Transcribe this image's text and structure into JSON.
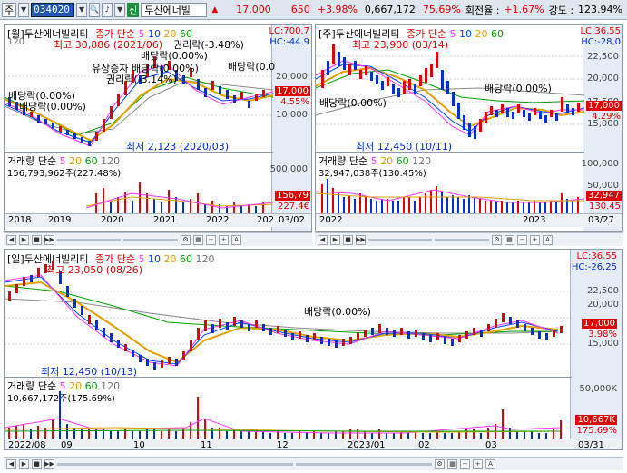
{
  "toolbar": {
    "mode": "주",
    "code": "034020",
    "badge": "신",
    "name": "두산에너빌",
    "price": "17,000",
    "arrow": "▲",
    "change": "650",
    "change_pct": "+3.98%",
    "volume": "0,667,172",
    "vol_pct": "75.69%",
    "turnover_label": "회전율 :",
    "turnover": "+1.67%",
    "strength_label": "강도 :",
    "strength": "123.94%"
  },
  "panels": {
    "monthly": {
      "title": "[월]두산에너빌리티",
      "ma_label": "종가 단순",
      "ma": [
        "5",
        "10",
        "20",
        "60"
      ],
      "ma120": "120",
      "lc": "LC:700.7",
      "hc": "HC:-44.9",
      "high_note": "최고 30,886 (2021/06)",
      "low_note": "최저 2,123 (2020/03)",
      "events": [
        "배당락(0.00%)",
        "유상증자 배당락(0.00%)",
        "권리락(-3.14%)",
        "배당락(0.00%)",
        "권리락(-3.48%)",
        "배당락(0.0",
        "배당락(0.00%)"
      ],
      "price_box": "17,000",
      "pct_box": "4.55%",
      "ticks": [
        "20,000",
        "10,000"
      ],
      "vol_title": "거래량 단순",
      "vol_ma": [
        "5",
        "20",
        "60",
        "120"
      ],
      "vol_text": "156,793,962주(227.48%)",
      "vol_tick": "500,000",
      "vol_box1": "156,79",
      "vol_box2": "227.4€",
      "x_labels": [
        "2018",
        "2019",
        "2020",
        "2021",
        "2022",
        "202"
      ],
      "date": "03/02"
    },
    "weekly": {
      "title": "[주]두산에너빌리티",
      "ma_label": "종가 단순",
      "ma": [
        "5",
        "10",
        "20",
        "60"
      ],
      "lc": "LC:36,55",
      "hc": "HC:-28,0",
      "high_note": "최고 23,900 (03/14)",
      "low_note": "최저 12,450 (10/11)",
      "events": [
        "배당락(0.00%)",
        "배당락(0.00%)"
      ],
      "price_box": "17,000",
      "pct_box": "4.29%",
      "ticks": [
        "22,500",
        "20,000",
        "17,500",
        "15,000"
      ],
      "vol_title": "거래량 단순",
      "vol_ma": [
        "5",
        "20",
        "60",
        "120"
      ],
      "vol_text": "32,947,038주(130.45%)",
      "vol_tick": "100,000",
      "vol_tick2": "50,000",
      "vol_box1": "32,947",
      "vol_box2": "130.45",
      "x_labels": [
        "2022",
        "2023"
      ],
      "date": "03/27"
    },
    "daily": {
      "title": "[일]두산에너빌리티",
      "ma_label": "종가 단순",
      "ma": [
        "5",
        "10",
        "20",
        "60",
        "120"
      ],
      "lc": "LC:36.55",
      "hc": "HC:-26.25",
      "high_note": "최고 23,050 (08/26)",
      "low_note": "최저 12,450 (10/13)",
      "events": [
        "배당락(0.00%)"
      ],
      "price_box": "17,000",
      "pct_box": "3.98%",
      "ticks": [
        "22,500",
        "20,000",
        "17,500",
        "15,000"
      ],
      "vol_title": "거래량 단순",
      "vol_ma": [
        "5",
        "20",
        "60",
        "120"
      ],
      "vol_text": "10,667,172주(175.69%)",
      "vol_tick": "50,000K",
      "vol_box1": "10,667K",
      "vol_box2": "175.69%",
      "x_labels": [
        "2022/08",
        "09",
        "10",
        "11",
        "12",
        "2023/01",
        "02",
        "03"
      ],
      "date": "03/31"
    }
  },
  "colors": {
    "up": "#e00000",
    "down": "#0030d0",
    "ma5": "#ff33ff",
    "ma10": "#0044ff",
    "ma20": "#e0a000",
    "ma60": "#00a000",
    "ma120": "#888888"
  },
  "controls": {
    "buttons": [
      "◀",
      "▶",
      "■",
      "▶▶"
    ],
    "zoom_out": "−",
    "zoom_in": "+",
    "text_tool": "A"
  }
}
